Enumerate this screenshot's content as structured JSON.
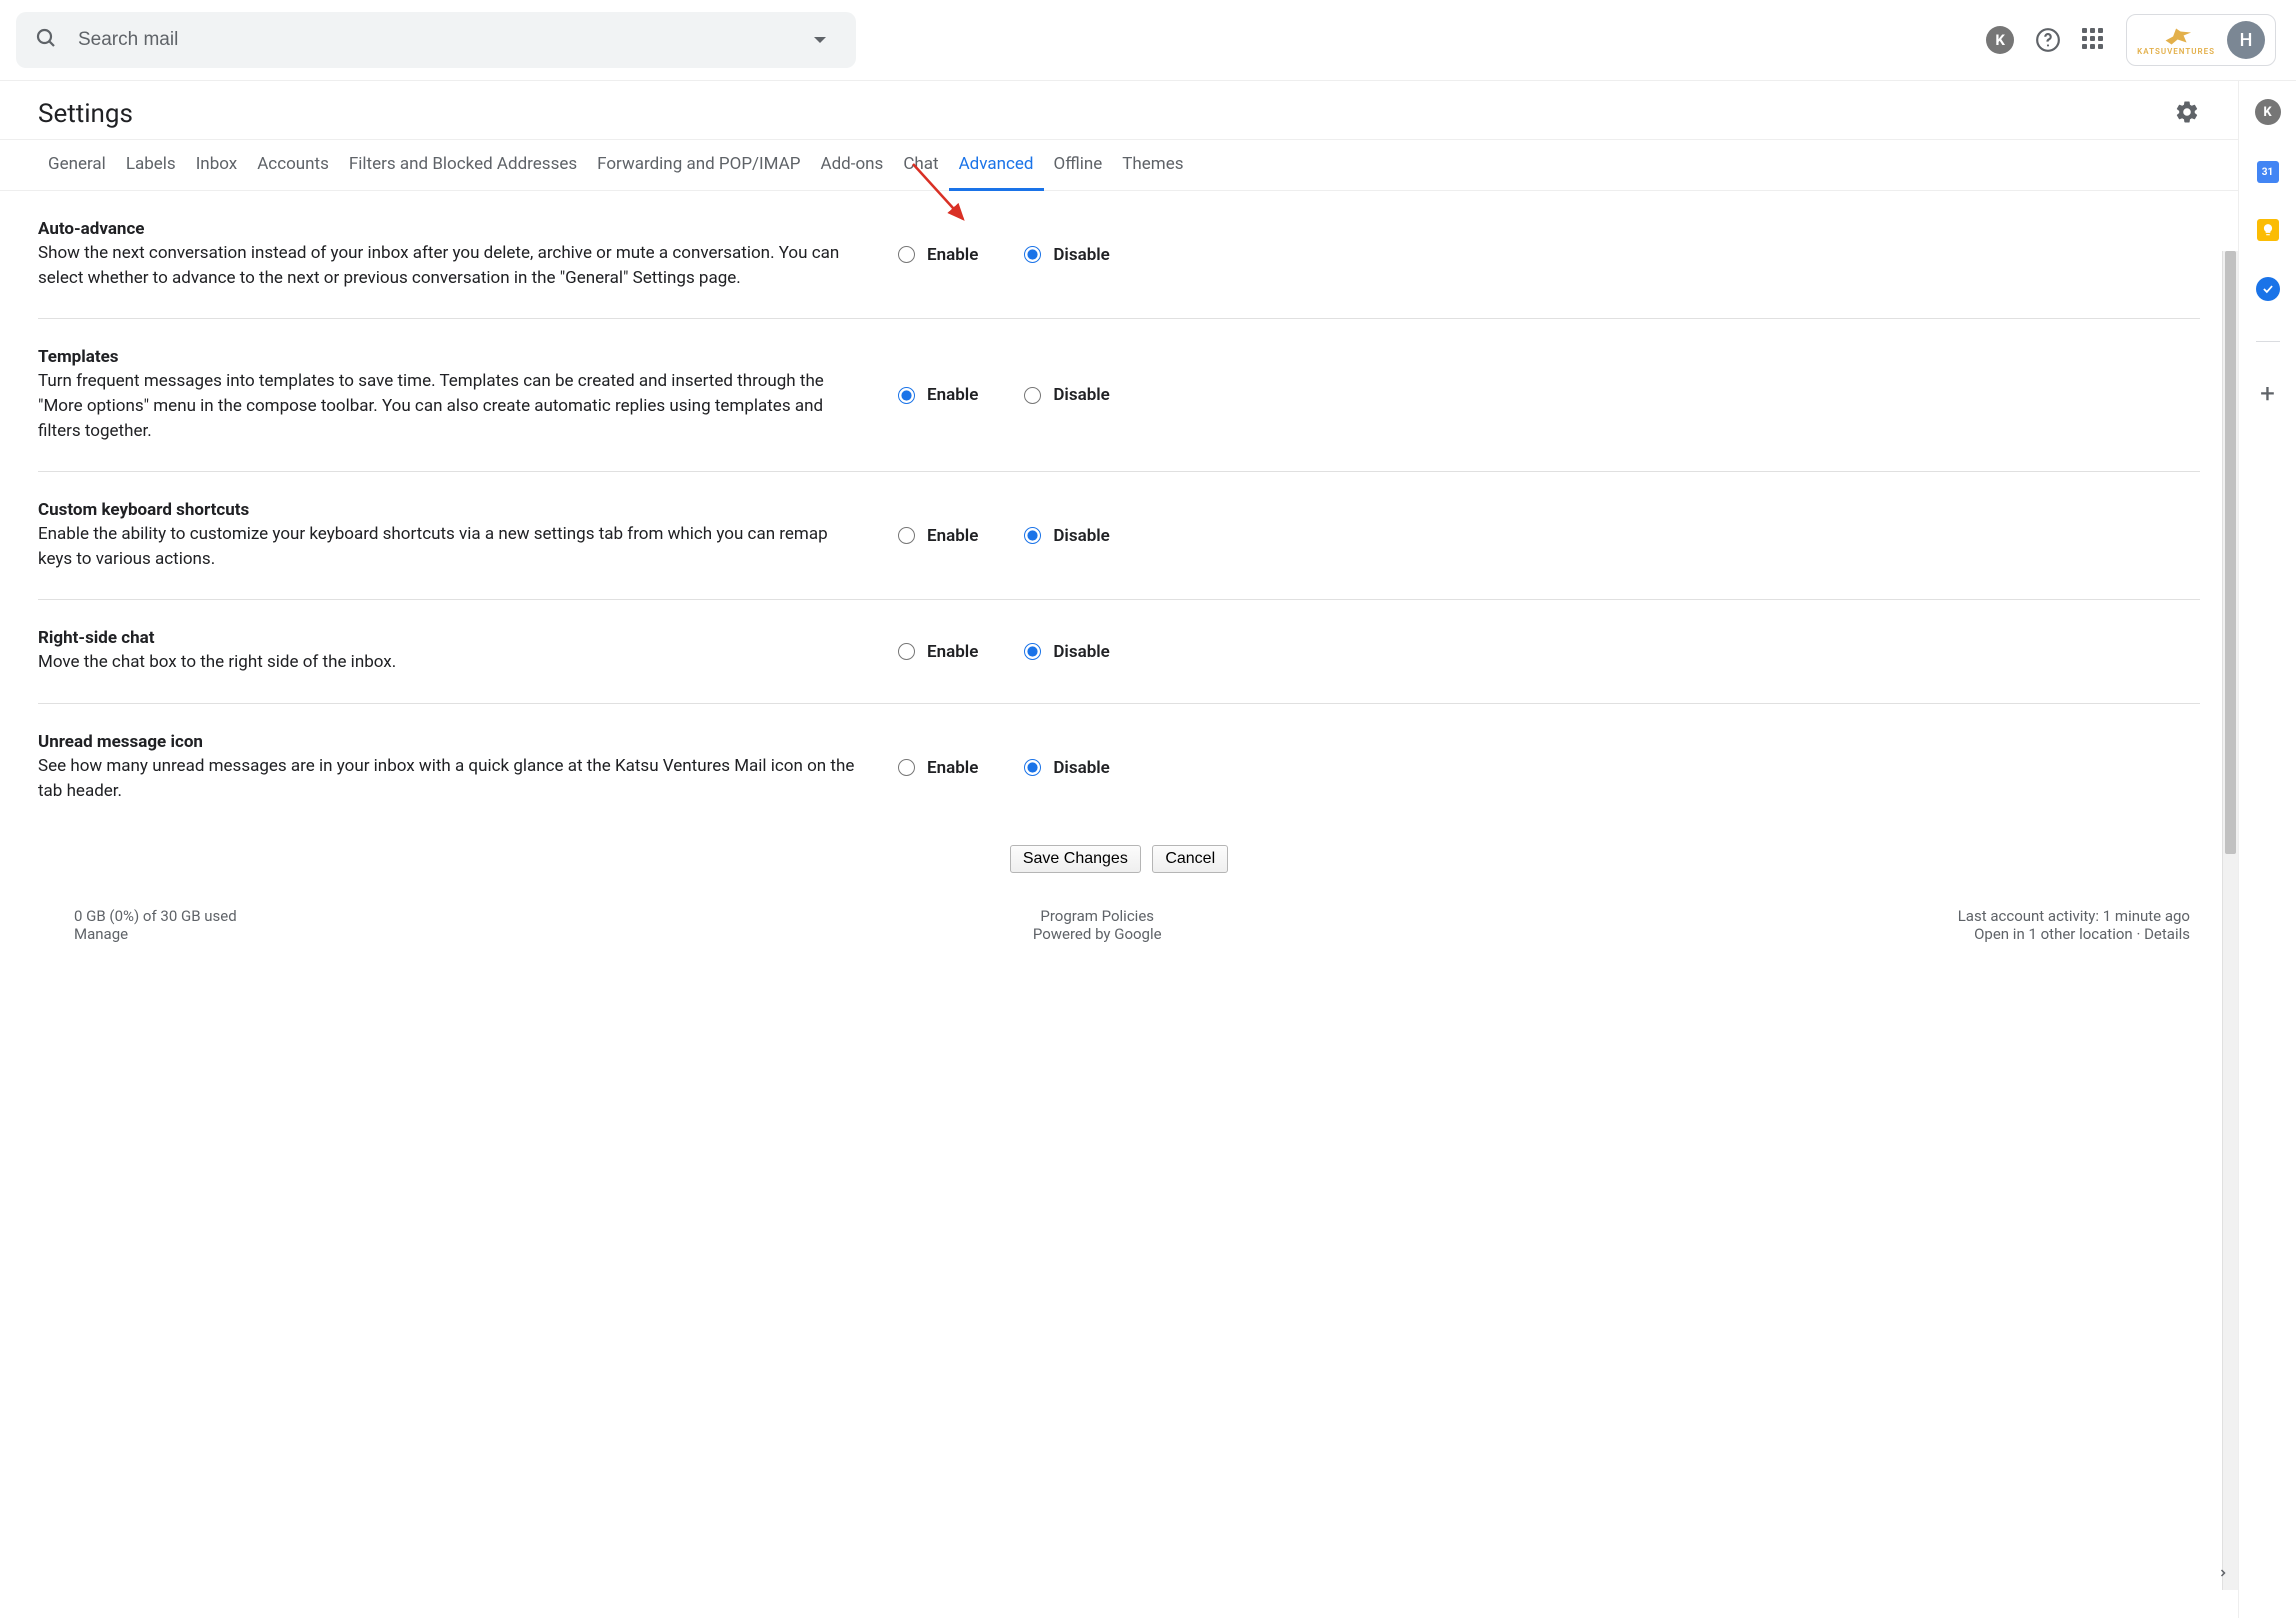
{
  "header": {
    "search_placeholder": "Search mail",
    "org_name": "KATSUVENTURES",
    "avatar_letter": "H"
  },
  "settings": {
    "title": "Settings",
    "tabs": [
      {
        "label": "General"
      },
      {
        "label": "Labels"
      },
      {
        "label": "Inbox"
      },
      {
        "label": "Accounts"
      },
      {
        "label": "Filters and Blocked Addresses"
      },
      {
        "label": "Forwarding and POP/IMAP"
      },
      {
        "label": "Add-ons"
      },
      {
        "label": "Chat"
      },
      {
        "label": "Advanced",
        "active": true
      },
      {
        "label": "Offline"
      },
      {
        "label": "Themes"
      }
    ],
    "enable_label": "Enable",
    "disable_label": "Disable",
    "items": [
      {
        "title": "Auto-advance",
        "desc": "Show the next conversation instead of your inbox after you delete, archive or mute a conversation. You can select whether to advance to the next or previous conversation in the \"General\" Settings page.",
        "selected": "disable"
      },
      {
        "title": "Templates",
        "desc": "Turn frequent messages into templates to save time. Templates can be created and inserted through the \"More options\" menu in the compose toolbar. You can also create automatic replies using templates and filters together.",
        "selected": "enable"
      },
      {
        "title": "Custom keyboard shortcuts",
        "desc": "Enable the ability to customize your keyboard shortcuts via a new settings tab from which you can remap keys to various actions.",
        "selected": "disable"
      },
      {
        "title": "Right-side chat",
        "desc": "Move the chat box to the right side of the inbox.",
        "selected": "disable"
      },
      {
        "title": "Unread message icon",
        "desc": "See how many unread messages are in your inbox with a quick glance at the Katsu Ventures Mail icon on the tab header.",
        "selected": "disable"
      }
    ],
    "save_label": "Save Changes",
    "cancel_label": "Cancel"
  },
  "footer": {
    "storage": "0 GB (0%) of 30 GB used",
    "manage": "Manage",
    "policies": "Program Policies",
    "powered": "Powered by Google",
    "activity": "Last account activity: 1 minute ago",
    "open_in": "Open in 1 other location",
    "details": "Details"
  },
  "sidepanel": {
    "calendar_day": "31"
  }
}
